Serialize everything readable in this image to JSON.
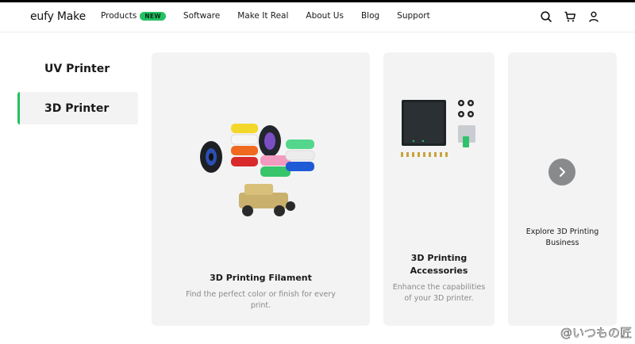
{
  "brand": {
    "logo_text": "eufy Make",
    "accent_color": "#23c162"
  },
  "nav": {
    "items": [
      {
        "label": "Products",
        "badge": "NEW"
      },
      {
        "label": "Software"
      },
      {
        "label": "Make It Real"
      },
      {
        "label": "About Us"
      },
      {
        "label": "Blog"
      },
      {
        "label": "Support"
      }
    ],
    "icons": [
      "search-icon",
      "cart-icon",
      "user-icon"
    ]
  },
  "sidebar": {
    "items": [
      {
        "label": "UV Printer",
        "active": false
      },
      {
        "label": "3D Printer",
        "active": true
      }
    ]
  },
  "cards": [
    {
      "title": "3D Printing Filament",
      "description": "Find the perfect color or finish for every print.",
      "image": "filament-spools-and-jeep-model"
    },
    {
      "title": "3D Printing Accessories",
      "description": "Enhance the capabilities of your 3D printer.",
      "image": "build-plate-nozzles-extruder"
    },
    {
      "title": "Explore 3D Printing Business",
      "icon": "chevron-right-icon"
    }
  ],
  "watermark": "@いつもの匠"
}
